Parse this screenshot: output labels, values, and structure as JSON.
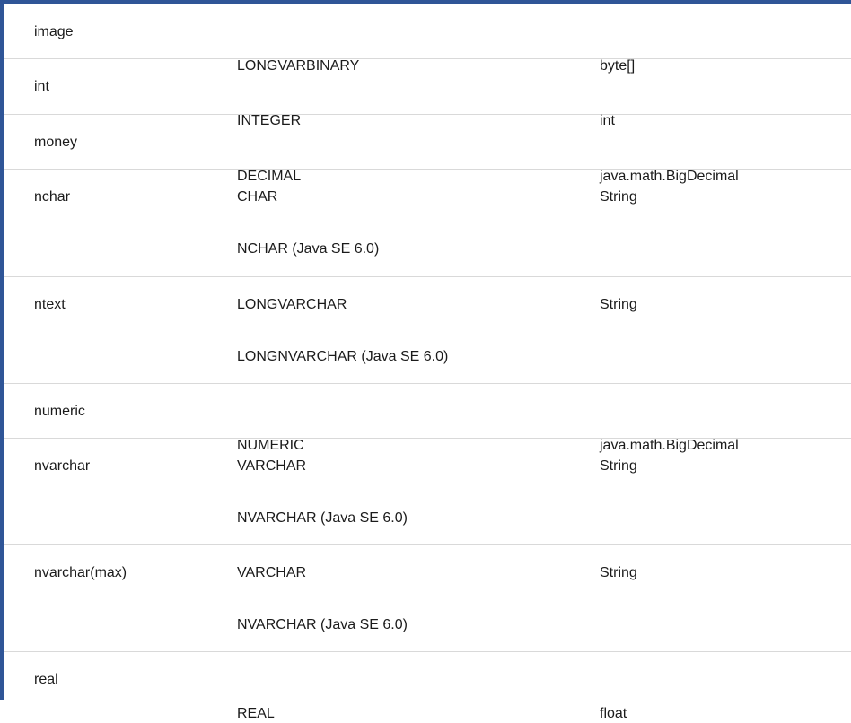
{
  "table": {
    "rows": [
      {
        "sql": "image",
        "jdbc": [
          "LONGVARBINARY"
        ],
        "java": "byte[]"
      },
      {
        "sql": "int",
        "jdbc": [
          "INTEGER"
        ],
        "java": "int"
      },
      {
        "sql": "money",
        "jdbc": [
          "DECIMAL"
        ],
        "java": "java.math.BigDecimal"
      },
      {
        "sql": "nchar",
        "jdbc": [
          "CHAR",
          "NCHAR (Java SE 6.0)"
        ],
        "java": "String"
      },
      {
        "sql": "ntext",
        "jdbc": [
          "LONGVARCHAR",
          "LONGNVARCHAR (Java SE 6.0)"
        ],
        "java": "String"
      },
      {
        "sql": "numeric",
        "jdbc": [
          "NUMERIC"
        ],
        "java": "java.math.BigDecimal"
      },
      {
        "sql": "nvarchar",
        "jdbc": [
          "VARCHAR",
          "NVARCHAR (Java SE 6.0)"
        ],
        "java": "String"
      },
      {
        "sql": "nvarchar(max)",
        "jdbc": [
          "VARCHAR",
          "NVARCHAR (Java SE 6.0)"
        ],
        "java": "String"
      },
      {
        "sql": "real",
        "jdbc": [
          "REAL"
        ],
        "java": "float"
      }
    ]
  }
}
